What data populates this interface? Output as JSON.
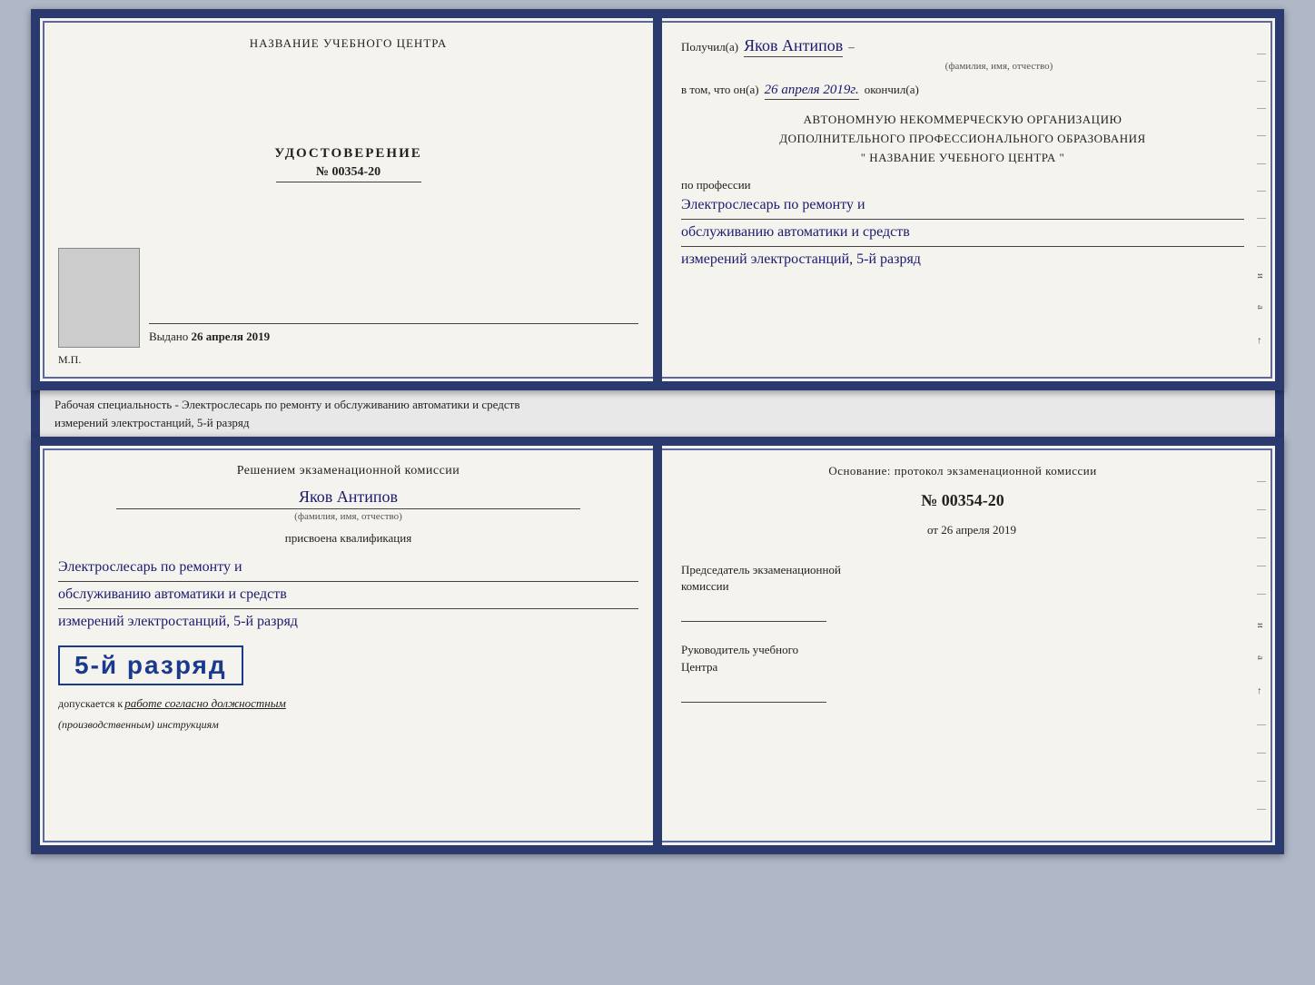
{
  "topDoc": {
    "left": {
      "institutionName": "НАЗВАНИЕ УЧЕБНОГО ЦЕНТРА",
      "certLabel": "УДОСТОВЕРЕНИЕ",
      "certNumber": "№ 00354-20",
      "issuedPrefix": "Выдано",
      "issuedDate": "26 апреля 2019",
      "mpLabel": "М.П."
    },
    "right": {
      "receivedPrefix": "Получил(а)",
      "recipientName": "Яков Антипов",
      "fioHint": "(фамилия, имя, отчество)",
      "inThatLine": "в том, что он(а)",
      "completedDate": "26 апреля 2019г.",
      "completedSuffix": "окончил(а)",
      "orgLine1": "АВТОНОМНУЮ НЕКОММЕРЧЕСКУЮ ОРГАНИЗАЦИЮ",
      "orgLine2": "ДОПОЛНИТЕЛЬНОГО ПРОФЕССИОНАЛЬНОГО ОБРАЗОВАНИЯ",
      "orgLine3": "\" НАЗВАНИЕ УЧЕБНОГО ЦЕНТРА \"",
      "professionLabel": "по профессии",
      "professionLine1": "Электрослесарь по ремонту и",
      "professionLine2": "обслуживанию автоматики и средств",
      "professionLine3": "измерений электростанций, 5-й разряд"
    }
  },
  "specialtyText": "Рабочая специальность - Электрослесарь по ремонту и обслуживанию автоматики и средств\nизмерений электростанций, 5-й разряд",
  "bottomDoc": {
    "left": {
      "decisionText": "Решением экзаменационной комиссии",
      "recipientName": "Яков Антипов",
      "fioHint": "(фамилия, имя, отчество)",
      "assignedLabel": "присвоена квалификация",
      "qualLine1": "Электрослесарь по ремонту и",
      "qualLine2": "обслуживанию автоматики и средств",
      "qualLine3": "измерений электростанций, 5-й разряд",
      "rankBadge": "5-й разряд",
      "allowedPrefix": "допускается к",
      "allowedText": "работе согласно должностным",
      "allowedText2": "(производственным) инструкциям"
    },
    "right": {
      "basisLabel": "Основание: протокол экзаменационной комиссии",
      "protocolNumber": "№ 00354-20",
      "fromDate": "от 26 апреля 2019",
      "chairmanTitle": "Председатель экзаменационной\nкомиссии",
      "leaderTitle": "Руководитель учебного\nЦентра"
    }
  }
}
